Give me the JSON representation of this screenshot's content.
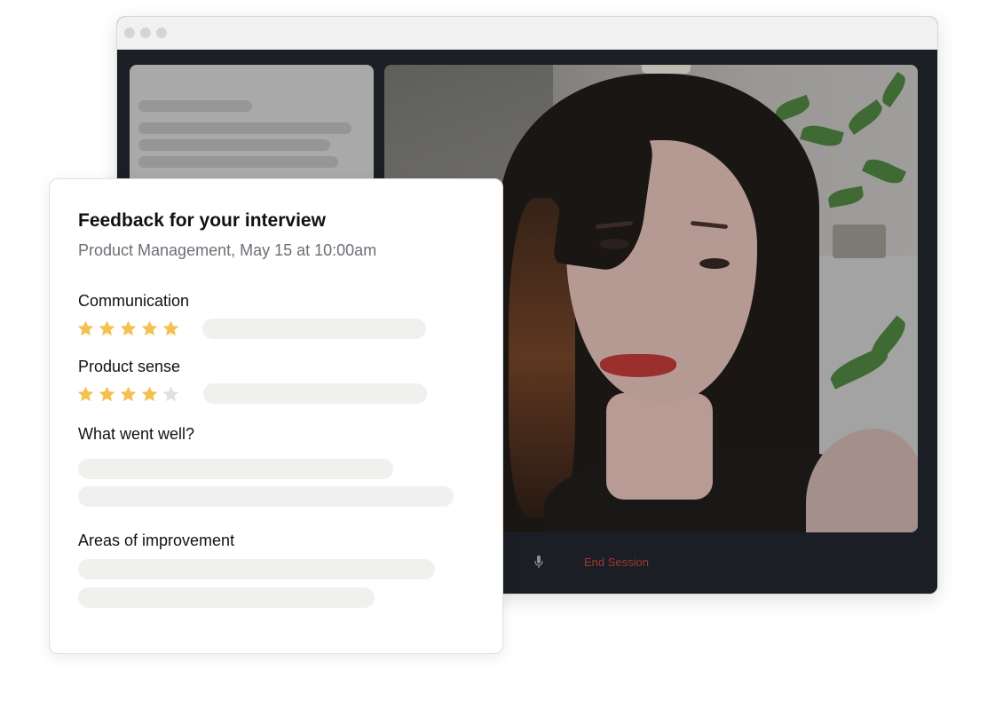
{
  "session": {
    "end_label": "End Session"
  },
  "feedback": {
    "title": "Feedback for your interview",
    "subtitle": "Product Management, May 15 at 10:00am",
    "ratings": [
      {
        "label": "Communication",
        "stars": 5,
        "max": 5
      },
      {
        "label": "Product sense",
        "stars": 4,
        "max": 5
      }
    ],
    "went_well_label": "What went well?",
    "improvement_label": "Areas of improvement"
  },
  "colors": {
    "star_filled": "#f2c14e",
    "star_empty": "#e0e0e0",
    "end_session": "#9a3a32"
  }
}
